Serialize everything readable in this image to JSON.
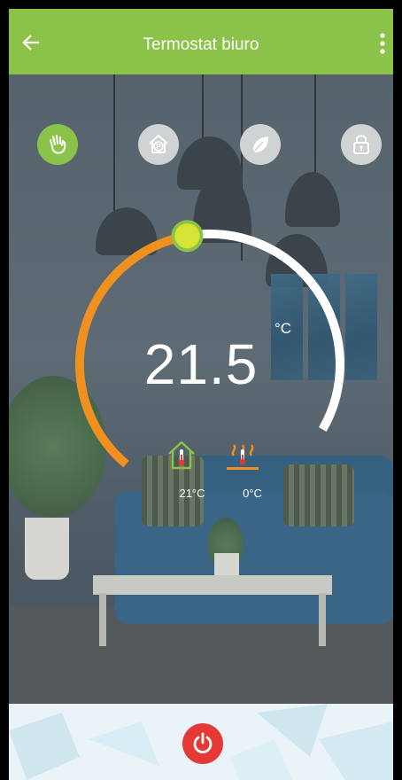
{
  "header": {
    "title": "Termostat biuro",
    "background_color": "#8bc34a",
    "back_icon": "arrow-left-icon",
    "menu_icon": "more-vertical-icon"
  },
  "modes": [
    {
      "name": "manual",
      "icon": "hand-icon",
      "active": true
    },
    {
      "name": "program",
      "icon": "house-program-icon",
      "active": false
    },
    {
      "name": "eco",
      "icon": "leaf-icon",
      "active": false
    },
    {
      "name": "lock",
      "icon": "lock-icon",
      "active": false
    }
  ],
  "thermostat": {
    "set_temperature": "21.5",
    "unit": "°C",
    "dial_fraction": 0.5,
    "arc_active_color": "#f0901e",
    "arc_inactive_color": "#ffffff",
    "knob_color": "#d6e535"
  },
  "sensors": [
    {
      "icon": "house-thermometer-icon",
      "value": "21°C"
    },
    {
      "icon": "floor-heating-icon",
      "value": "0°C"
    }
  ],
  "footer": {
    "power_icon": "power-icon",
    "power_color": "#e53935"
  }
}
